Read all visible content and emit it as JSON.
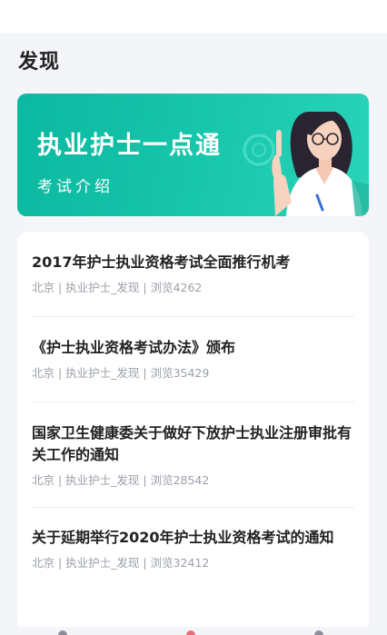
{
  "page": {
    "title": "发现"
  },
  "banner": {
    "title": "执业护士一点通",
    "subtitle": "考试介绍",
    "colors": {
      "start": "#0bb8a0",
      "end": "#29d4b9"
    }
  },
  "articles": [
    {
      "title": "2017年护士执业资格考试全面推行机考",
      "meta": "北京 | 执业护士_发现 | 浏览4262"
    },
    {
      "title": "《护士执业资格考试办法》颁布",
      "meta": "北京 | 执业护士_发现 | 浏览35429"
    },
    {
      "title": "国家卫生健康委关于做好下放护士执业注册审批有关工作的通知",
      "meta": "北京 | 执业护士_发现 | 浏览28542"
    },
    {
      "title": "关于延期举行2020年护士执业资格考试的通知",
      "meta": "北京 | 执业护士_发现 | 浏览32412"
    }
  ]
}
